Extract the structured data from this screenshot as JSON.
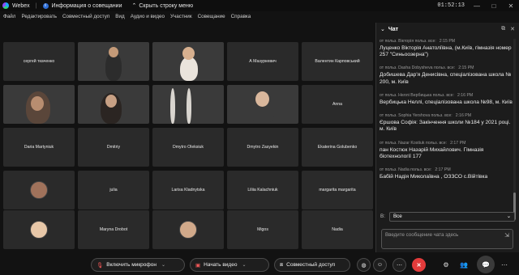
{
  "titlebar": {
    "app": "Webex",
    "meeting_info": "Информация о совещании",
    "hide_menu": "Скрыть строку меню",
    "clock": "01:52:13"
  },
  "menu": [
    "Файл",
    "Редактировать",
    "Совместный доступ",
    "Вид",
    "Аудио и видео",
    "Участник",
    "Совещание",
    "Справка"
  ],
  "participants": {
    "r1c1": "сергей ткаченко",
    "r1c4": "А Мазуркевич",
    "r1c5": "Валентин Карповський",
    "r2c5": "Anna",
    "r3": [
      "Daria Martyniuk",
      "Dmitriy",
      "Dmytro Oleksiuk",
      "Dmytro Zasyekin",
      "Ekaterina Golubenko"
    ],
    "r4": [
      "julia",
      "Larisa Kladnytska",
      "Liliia Kalachniuk",
      "margarita margarita"
    ],
    "r5": [
      "Maryna Drobot",
      "Migos",
      "Nadia"
    ]
  },
  "chat": {
    "title": "Чат",
    "to_label": "В:",
    "to_value": "Все",
    "input_placeholder": "Введите сообщение чата здесь",
    "messages": [
      {
        "meta": "от польз. Вікторія польз. все:",
        "time": "2:15 PM",
        "text": "Луценко Вікторія Анатоліївна, (м.Київ, гімназія  номер 257 \"Синьоозерна\")"
      },
      {
        "meta": "от польз. Dasha Dobysheva польз. все:",
        "time": "2:15 PM",
        "text": "Добишева Дар'я Денисівна, спеціалізована школа № 200, м. Київ"
      },
      {
        "meta": "от польз. Неллі Вербицька польз. все:",
        "time": "2:16 PM",
        "text": "Вербицька Неллі, спеціалізована школа №98, м. Київ"
      },
      {
        "meta": "от польз. Sophia Yershova польз. все:",
        "time": "2:16 PM",
        "text": "Єршова Софія: Закінчення школи №184 у 2021 році. м. Київ"
      },
      {
        "meta": "от польз. Nazar Kostiuk польз. все:",
        "time": "2:17 PM",
        "text": "пан Костюк Назарій Михайлович. Гімназія біотехнології 177"
      },
      {
        "meta": "от польз. Nadia польз. все:",
        "time": "2:17 PM",
        "text": "Бабій Надія Миколаївна ,  ОЗЗСО с.Війтівка"
      }
    ]
  },
  "controls": {
    "mic": "Включить микрофон",
    "video": "Начать видео",
    "share": "Совместный доступ"
  },
  "colors": {
    "background": "#121212",
    "tile": "#2a2a2a",
    "end_call": "#e33b3b",
    "muted_red": "#ff5b5b"
  }
}
